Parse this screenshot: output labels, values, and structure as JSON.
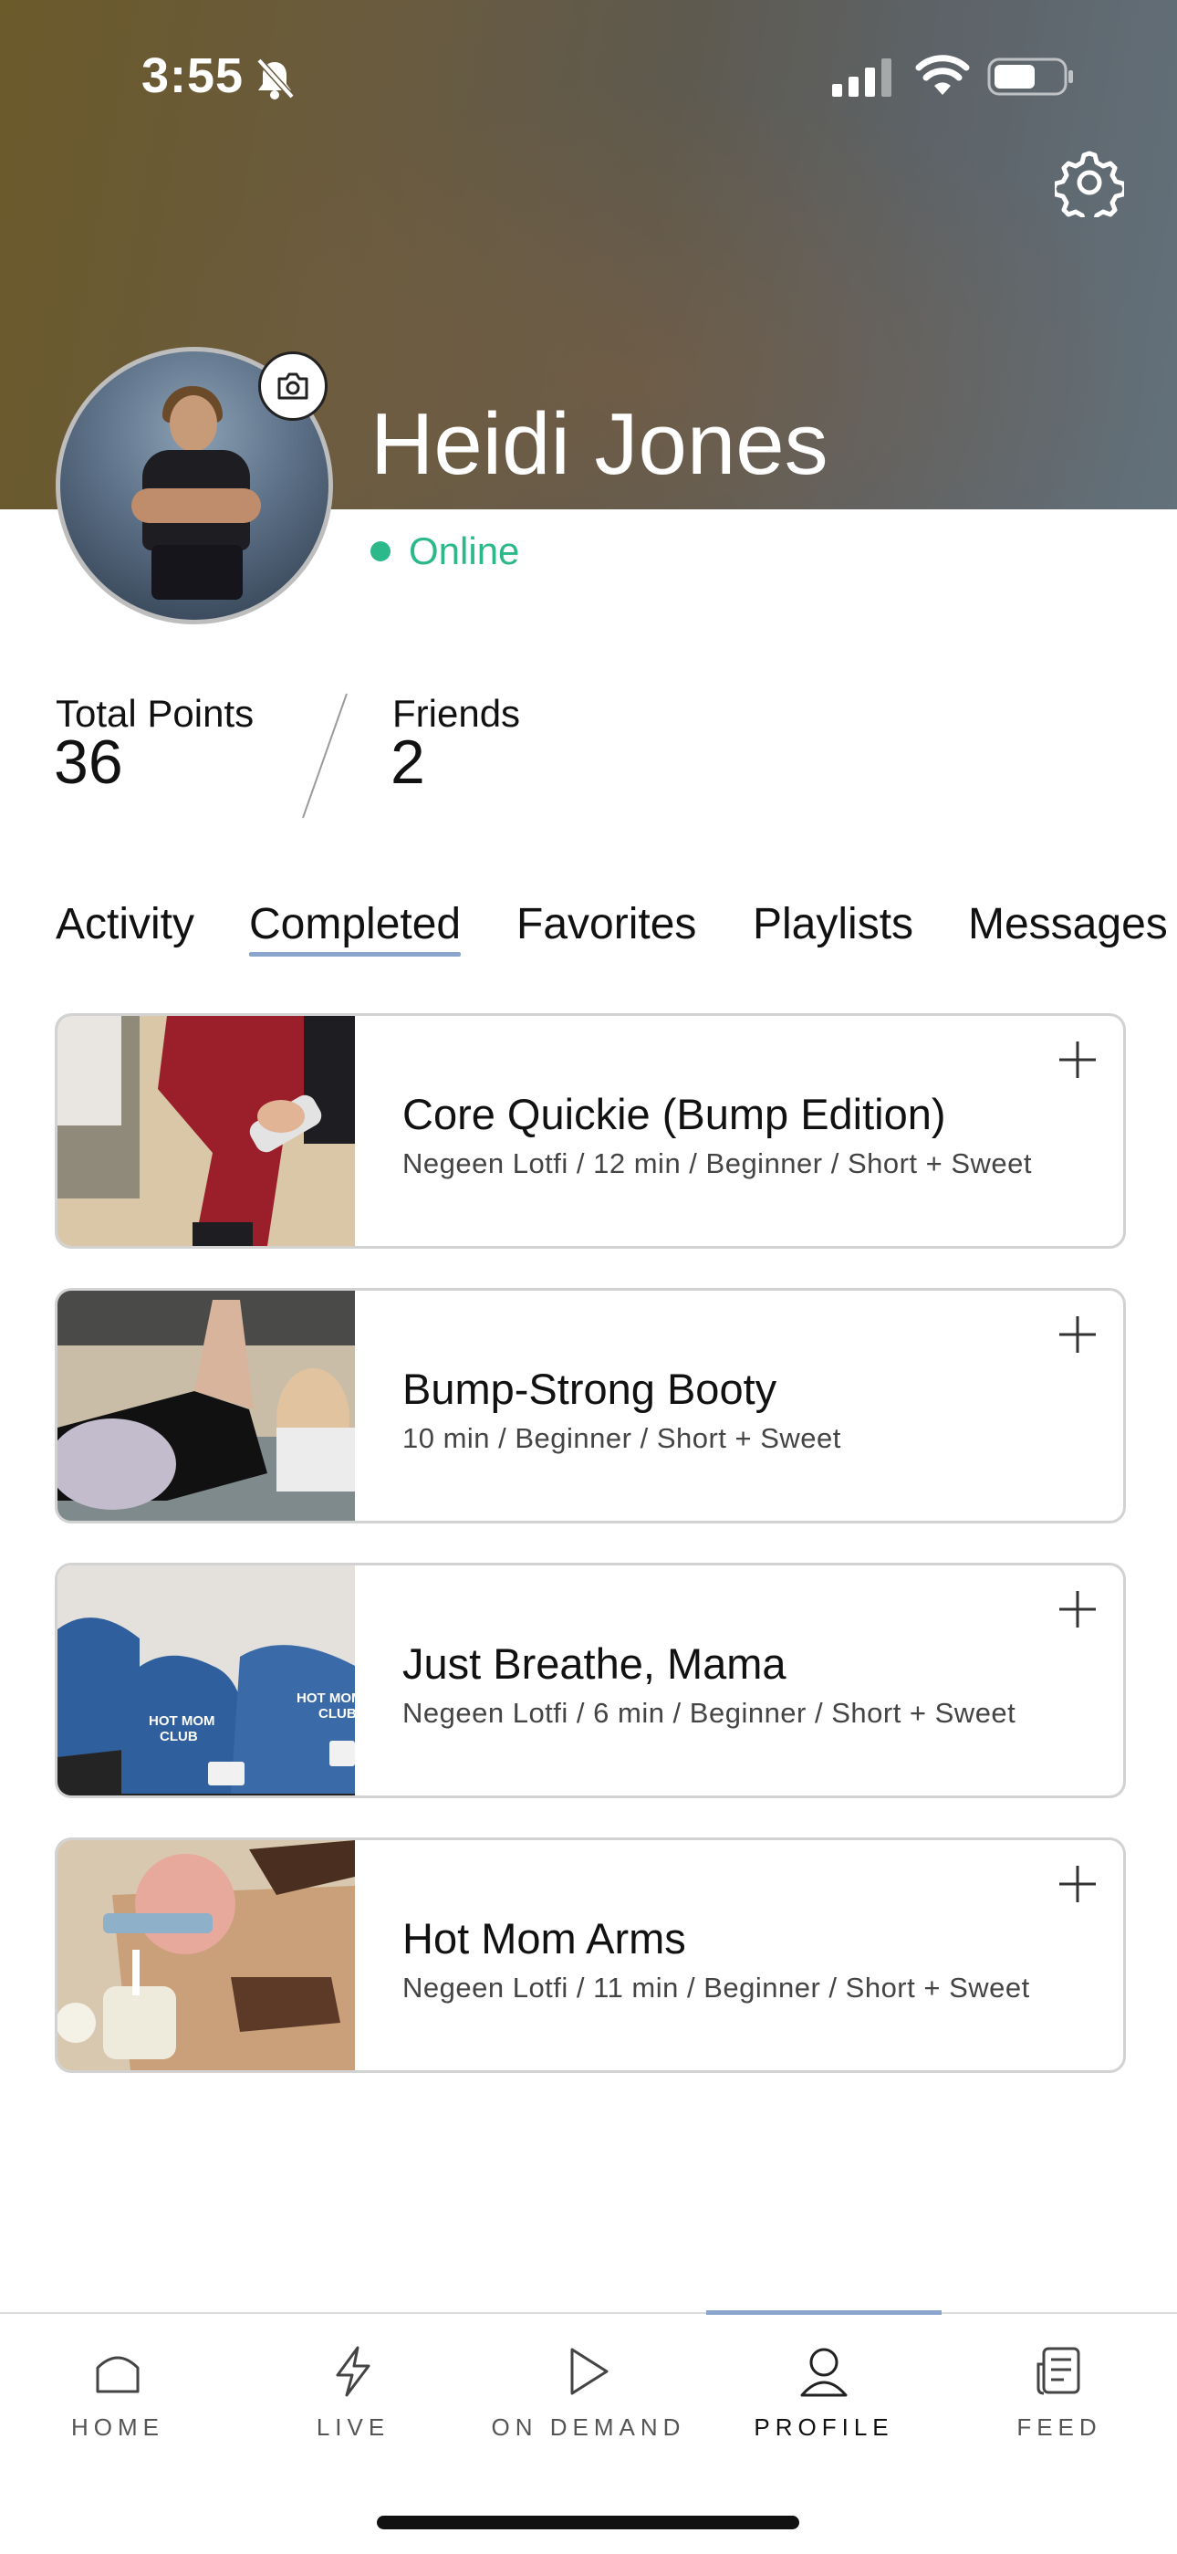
{
  "status_bar": {
    "time": "3:55"
  },
  "profile": {
    "name": "Heidi Jones",
    "status": "Online"
  },
  "stats": {
    "points_label": "Total Points",
    "points_value": "36",
    "friends_label": "Friends",
    "friends_value": "2"
  },
  "tabs": [
    {
      "label": "Activity"
    },
    {
      "label": "Completed"
    },
    {
      "label": "Favorites"
    },
    {
      "label": "Playlists"
    },
    {
      "label": "Messages"
    }
  ],
  "active_tab": "Completed",
  "workouts": [
    {
      "title": "Core Quickie (Bump Edition)",
      "meta": "Negeen Lotfi  /  12 min  /  Beginner  /  Short + Sweet"
    },
    {
      "title": "Bump-Strong Booty",
      "meta": "10 min  /  Beginner  /  Short + Sweet"
    },
    {
      "title": "Just Breathe, Mama",
      "meta": "Negeen Lotfi  /  6 min  /  Beginner  /  Short + Sweet",
      "thumb_text": [
        "HOT MOM",
        "CLUB",
        "HOT MOM",
        "CLUB"
      ]
    },
    {
      "title": "Hot Mom Arms",
      "meta": "Negeen Lotfi  /  11 min  /  Beginner  /  Short + Sweet"
    }
  ],
  "bottom_nav": [
    {
      "label": "HOME",
      "icon": "home-icon"
    },
    {
      "label": "LIVE",
      "icon": "lightning-icon"
    },
    {
      "label": "ON DEMAND",
      "icon": "play-icon"
    },
    {
      "label": "PROFILE",
      "icon": "person-icon"
    },
    {
      "label": "FEED",
      "icon": "news-icon"
    }
  ],
  "active_nav": "PROFILE",
  "colors": {
    "online_green": "#2bb88a",
    "accent_underline": "#8aa6cc"
  }
}
